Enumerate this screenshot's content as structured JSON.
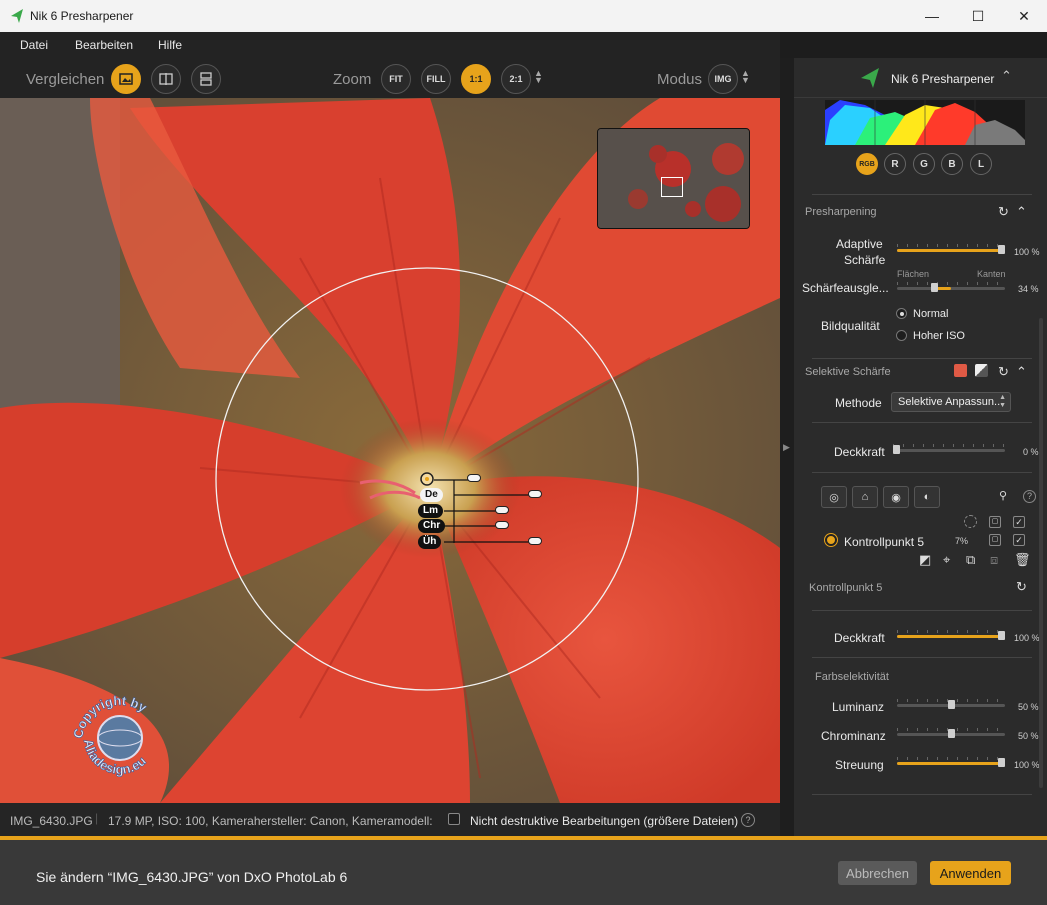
{
  "window": {
    "title": "Nik 6 Presharpener",
    "minimize": "—",
    "maximize": "☐",
    "close": "✕"
  },
  "menu": [
    "Datei",
    "Bearbeiten",
    "Hilfe"
  ],
  "toolbar": {
    "compare_label": "Vergleichen",
    "zoom_label": "Zoom",
    "zoom_options": [
      "FIT",
      "FILL",
      "1:1",
      "2:1"
    ],
    "zoom_active": "1:1",
    "mode_label": "Modus",
    "mode_value": "IMG"
  },
  "control_point": {
    "labels": [
      "De",
      "Lm",
      "Chr",
      "Üh"
    ]
  },
  "watermark": {
    "line1": "Copyright by",
    "line2": "Aliadesign.eu"
  },
  "status": {
    "filename": "IMG_6430.JPG",
    "info": "17.9 MP, ISO: 100, Kamerahersteller: Canon, Kameramodell: Ca...",
    "nondestructive_label": "Nicht destruktive Bearbeitungen (größere Dateien)",
    "help": "?"
  },
  "panel": {
    "brand": "Nik 6 Presharpener",
    "channels": [
      "RGB",
      "R",
      "G",
      "B",
      "L"
    ],
    "presharpening": {
      "title": "Presharpening",
      "adaptive_label_1": "Adaptive",
      "adaptive_label_2": "Schärfe",
      "adaptive_value": "100 %",
      "adaptive_level": 1.0,
      "balance_label": "Schärfeausgle...",
      "balance_left": "Flächen",
      "balance_right": "Kanten",
      "balance_value": "34 %",
      "balance_level": 0.34,
      "quality_label": "Bildqualität",
      "quality_options": [
        "Normal",
        "Hoher ISO"
      ],
      "quality_selected": "Normal"
    },
    "selective": {
      "title": "Selektive Schärfe",
      "method_label": "Methode",
      "method_value": "Selektive Anpassun...",
      "opacity_label": "Deckkraft",
      "opacity_value": "0 %",
      "opacity_level": 0.0,
      "cp_name": "Kontrollpunkt 5",
      "cp_percent": "7%"
    },
    "controlpoint": {
      "title": "Kontrollpunkt 5",
      "opacity_label": "Deckkraft",
      "opacity_value": "100 %",
      "opacity_level": 1.0,
      "color_title": "Farbselektivität",
      "luminance_label": "Luminanz",
      "luminance_value": "50 %",
      "luminance_level": 0.5,
      "chrominance_label": "Chrominanz",
      "chrominance_value": "50 %",
      "chrominance_level": 0.5,
      "spread_label": "Streuung",
      "spread_value": "100 %",
      "spread_level": 1.0
    }
  },
  "footer": {
    "message": "Sie ändern “IMG_6430.JPG” von DxO PhotoLab 6",
    "cancel": "Abbrechen",
    "apply": "Anwenden"
  },
  "colors": {
    "accent": "#e7a31b",
    "petal": "#d9402f"
  }
}
